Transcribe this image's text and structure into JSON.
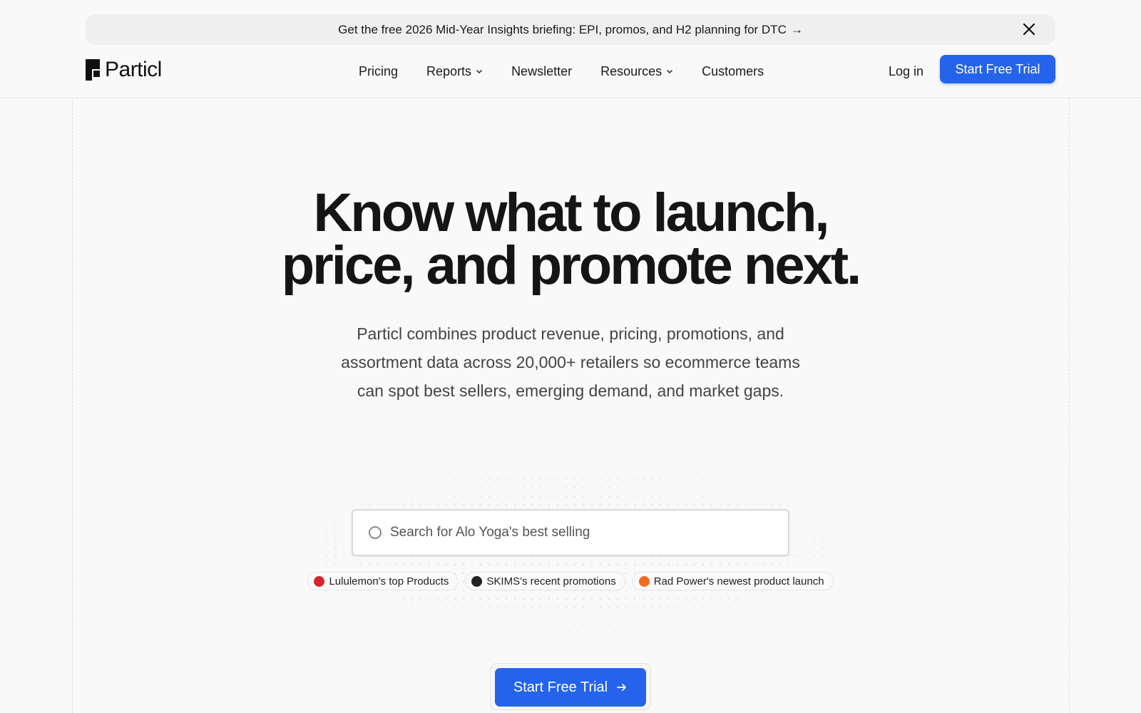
{
  "banner": {
    "text": "Get the free 2026 Mid-Year Insights briefing: EPI, promos, and H2 planning for DTC",
    "arrow": "→",
    "close_icon": "close-icon"
  },
  "nav": {
    "logo_text": "Particl",
    "items": [
      {
        "label": "Pricing",
        "dropdown": false
      },
      {
        "label": "Reports",
        "dropdown": true
      },
      {
        "label": "Newsletter",
        "dropdown": false
      },
      {
        "label": "Resources",
        "dropdown": true
      },
      {
        "label": "Customers",
        "dropdown": false
      }
    ],
    "login_label": "Log in",
    "cta_label": "Start Free Trial"
  },
  "hero": {
    "title_line1": "Know what to launch,",
    "title_line2": "price, and promote next.",
    "subtitle": "Particl combines product revenue, pricing, promotions, and assortment data across 20,000+ retailers so ecommerce teams can spot best sellers, emerging demand, and market gaps."
  },
  "search": {
    "placeholder": "Search for Alo Yoga's best selling",
    "value": ""
  },
  "suggestions": [
    {
      "label": "Lululemon's top Products",
      "icon": "lululemon-logo-icon",
      "color": "#d8232a"
    },
    {
      "label": "SKIMS's recent promotions",
      "icon": "skims-logo-icon",
      "color": "#222222"
    },
    {
      "label": "Rad Power's newest product launch",
      "icon": "rad-power-logo-icon",
      "color": "#f26b21"
    }
  ],
  "cta_main": {
    "label": "Start Free Trial",
    "arrow_icon": "arrow-right-icon"
  },
  "colors": {
    "accent": "#2563eb",
    "background": "#f9f9f9",
    "banner_bg": "#efefef"
  }
}
